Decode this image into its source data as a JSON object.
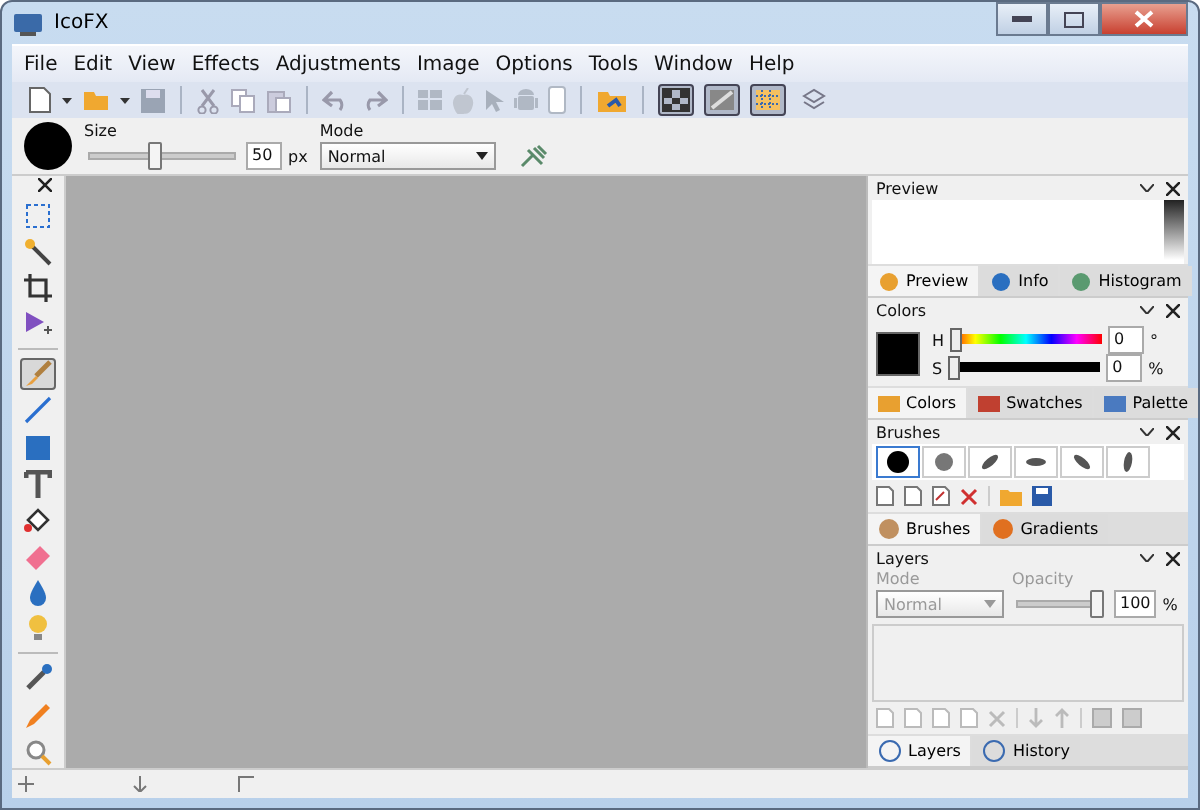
{
  "window": {
    "title": "IcoFX"
  },
  "menu": [
    "File",
    "Edit",
    "View",
    "Effects",
    "Adjustments",
    "Image",
    "Options",
    "Tools",
    "Window",
    "Help"
  ],
  "view_toggles": [
    {
      "selected": true
    },
    {
      "selected": true
    },
    {
      "selected": true
    },
    {
      "selected": false
    }
  ],
  "options_bar": {
    "size_label": "Size",
    "size": {
      "level": 0.45
    },
    "size_value": "50",
    "size_unit": "px",
    "mode_label": "Mode",
    "mode_value": "Normal"
  },
  "tools": [
    {
      "selected": false
    },
    {
      "selected": false
    },
    {
      "selected": false
    },
    {
      "selected": false
    },
    {
      "selected": true
    },
    {
      "selected": false
    },
    {
      "selected": false
    },
    {
      "selected": false
    },
    {
      "selected": false
    },
    {
      "selected": false
    },
    {
      "selected": false
    },
    {
      "selected": false
    },
    {
      "selected": false
    },
    {
      "selected": false
    },
    {
      "selected": false
    }
  ],
  "preview_panel": {
    "title": "Preview",
    "tabs": [
      {
        "label": "Preview",
        "selected": true
      },
      {
        "label": "Info",
        "selected": false
      },
      {
        "label": "Histogram",
        "selected": false
      }
    ]
  },
  "colors_panel": {
    "title": "Colors",
    "h_label": "H",
    "h": {
      "level": 0
    },
    "h_value": "0",
    "h_unit": "°",
    "s_label": "S",
    "s": {
      "level": 0
    },
    "s_value": "0",
    "s_unit": "%",
    "tabs": [
      {
        "label": "Colors",
        "selected": true
      },
      {
        "label": "Swatches",
        "selected": false
      },
      {
        "label": "Palette",
        "selected": false
      }
    ]
  },
  "brushes_panel": {
    "title": "Brushes",
    "brushes": [
      {
        "selected": true
      },
      {
        "selected": false
      },
      {
        "selected": false
      },
      {
        "selected": false
      },
      {
        "selected": false
      },
      {
        "selected": false
      }
    ],
    "tabs": [
      {
        "label": "Brushes",
        "selected": true
      },
      {
        "label": "Gradients",
        "selected": false
      }
    ]
  },
  "layers_panel": {
    "title": "Layers",
    "mode_label": "Mode",
    "mode_value": "Normal",
    "opacity_label": "Opacity",
    "opacity": {
      "level": 1
    },
    "opacity_value": "100",
    "opacity_unit": "%",
    "tabs": [
      {
        "label": "Layers",
        "selected": true
      },
      {
        "label": "History",
        "selected": false
      }
    ]
  }
}
